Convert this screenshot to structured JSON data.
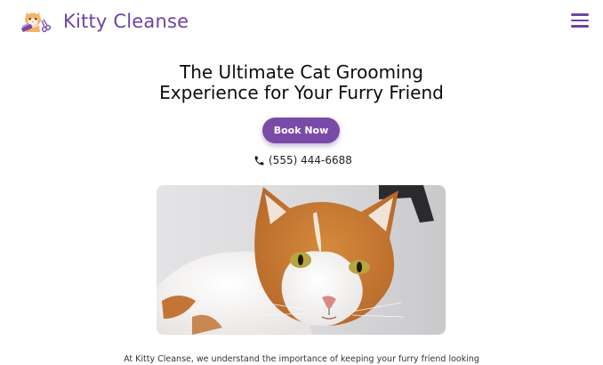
{
  "header": {
    "brand_name": "Kitty Cleanse",
    "logo_icon": "cat-grooming-logo-icon",
    "menu_icon": "hamburger-menu-icon"
  },
  "hero": {
    "headline_line1": "The Ultimate Cat Grooming",
    "headline_line2": "Experience for Your Furry Friend",
    "book_button_label": "Book Now",
    "phone_icon": "phone-icon",
    "phone_number": "(555) 444-6688",
    "image_alt": "orange and white cat"
  },
  "intro": {
    "text": "At Kitty Cleanse, we understand the importance of keeping your furry friend looking"
  },
  "colors": {
    "brand": "#6f42a6",
    "button": "#7a4aa8",
    "text": "#0c0c0c"
  }
}
